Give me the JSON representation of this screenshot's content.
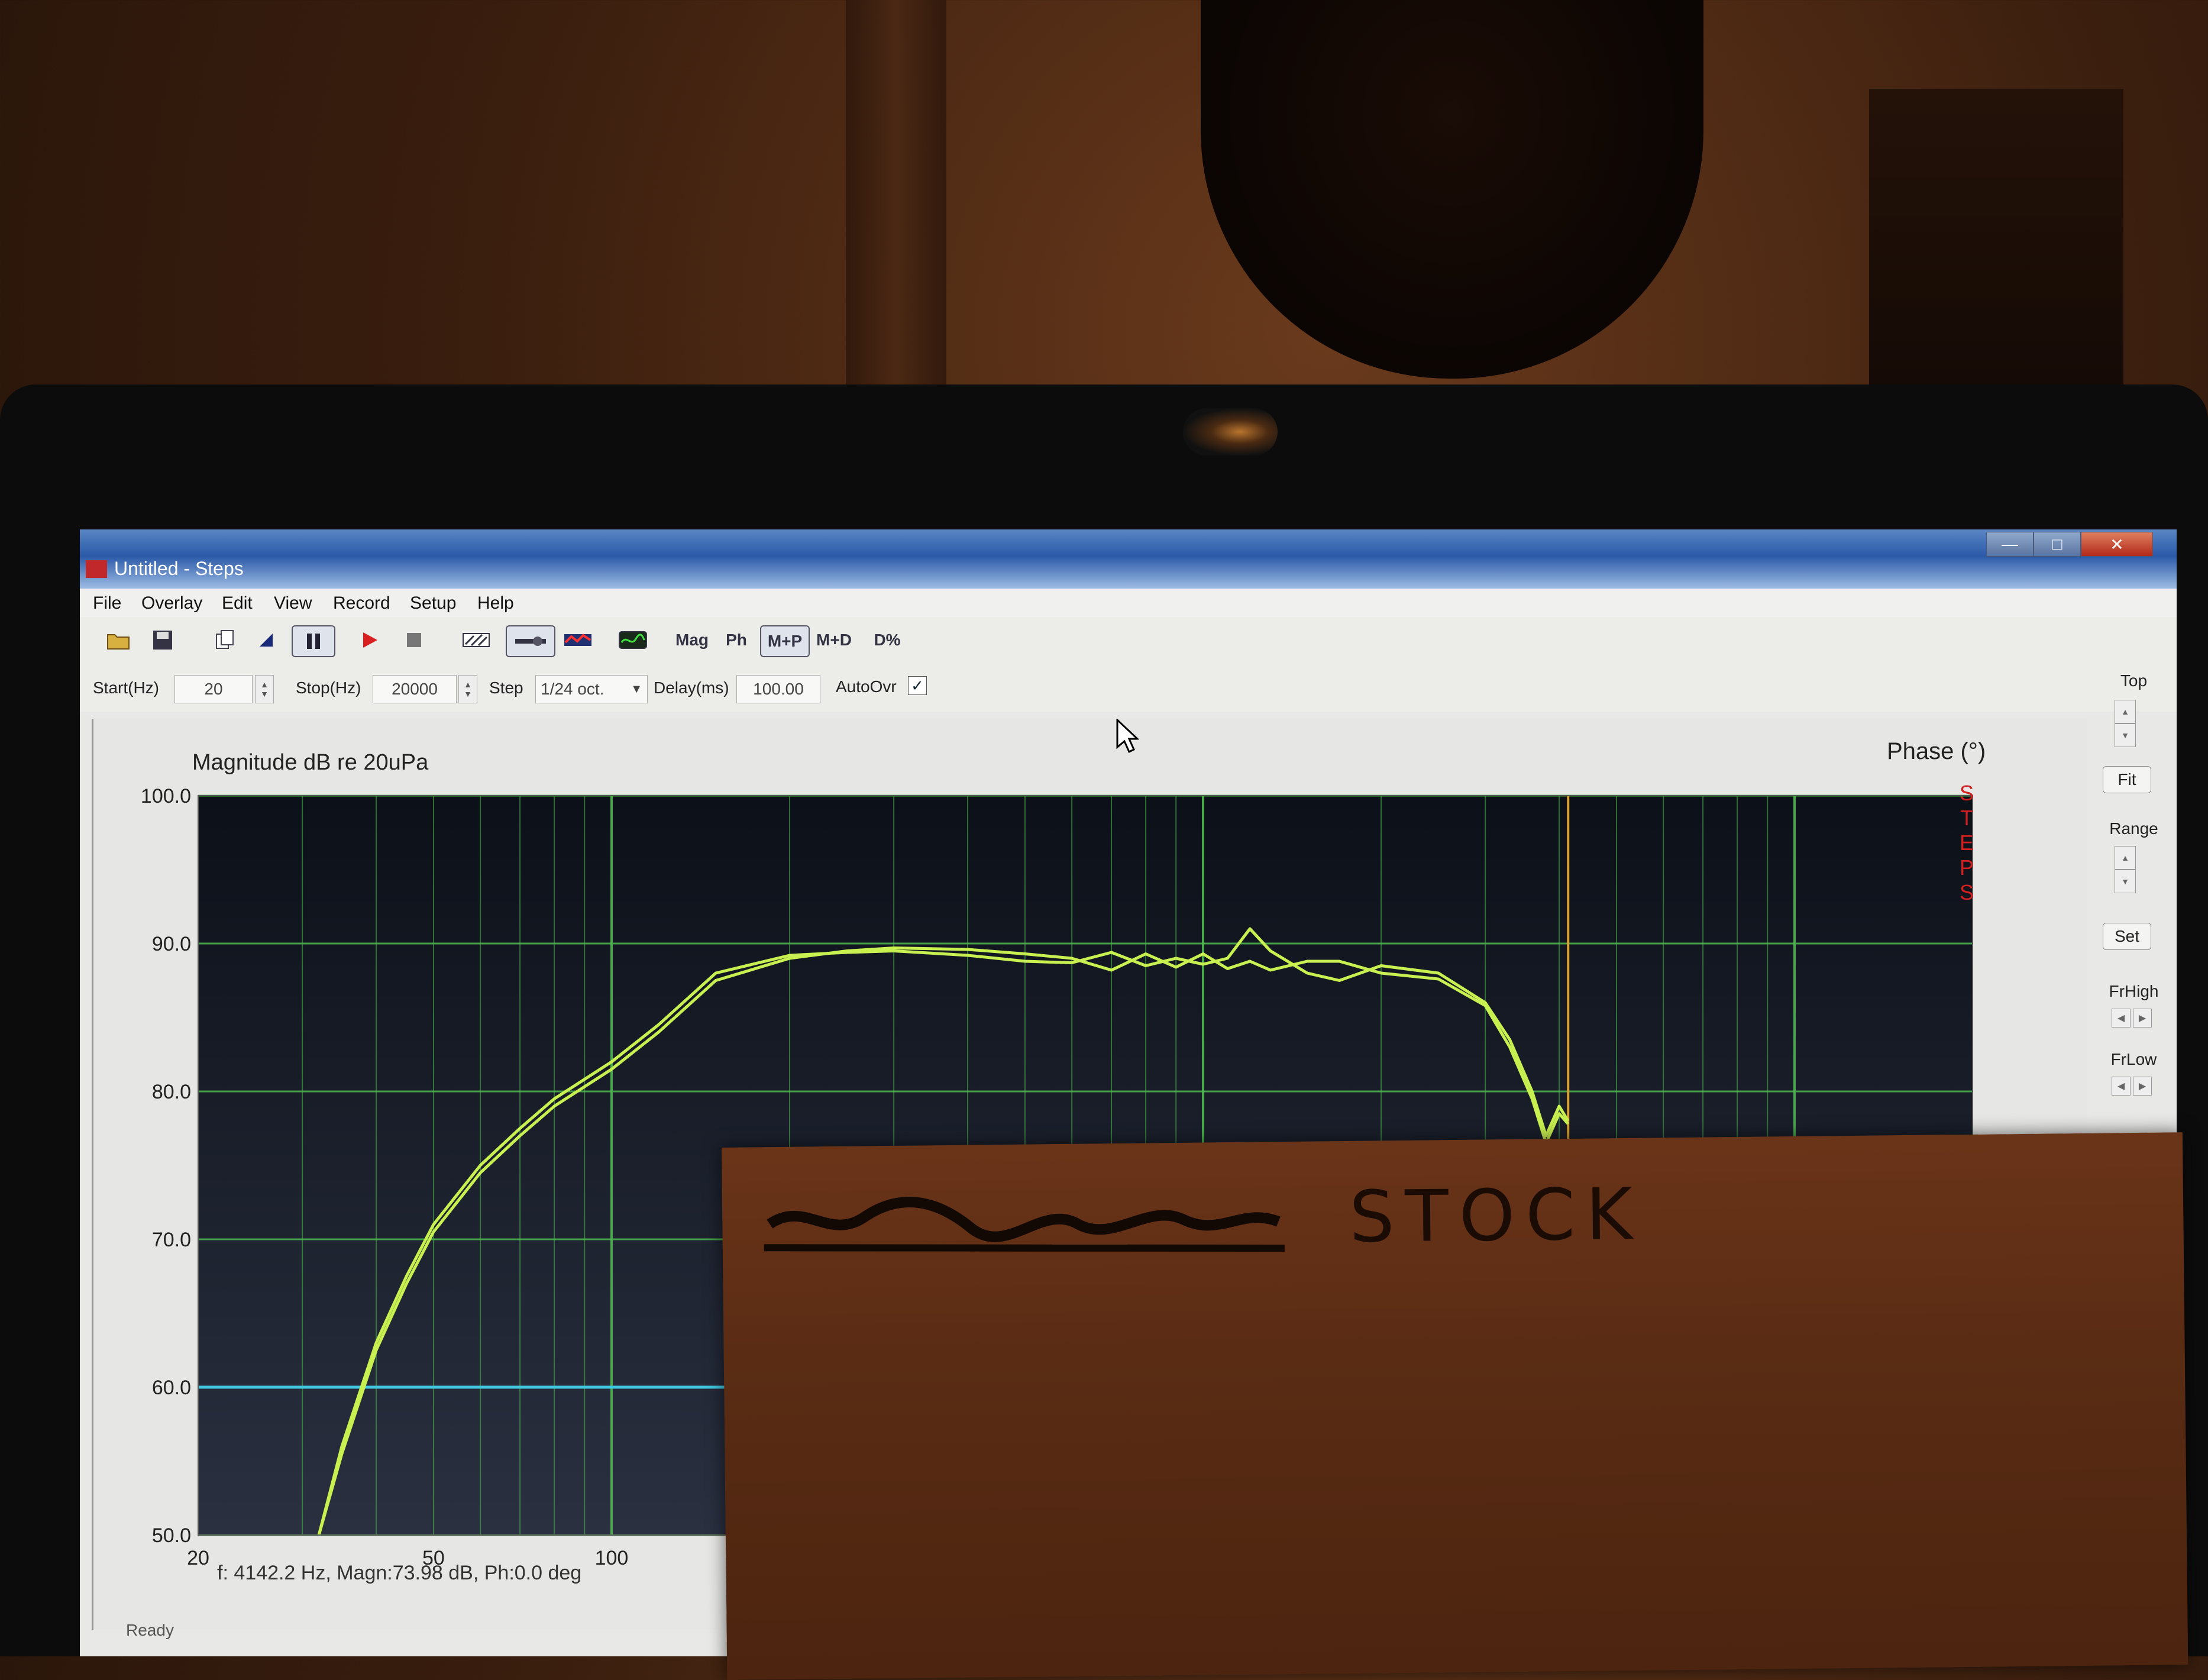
{
  "window": {
    "title": "Untitled - Steps",
    "buttons": [
      "—",
      "□",
      "✕"
    ]
  },
  "menu": [
    "File",
    "Overlay",
    "Edit",
    "View",
    "Record",
    "Setup",
    "Help"
  ],
  "toolbar": {
    "open_icon": "folder-open-icon",
    "save_icon": "floppy-disk-icon",
    "mag_label": "Mag",
    "ph_label": "Ph",
    "mp_label": "M+P",
    "md_label": "M+D",
    "dpct_label": "D%"
  },
  "params": {
    "start_label": "Start(Hz)",
    "start_value": "20",
    "stop_label": "Stop(Hz)",
    "stop_value": "20000",
    "step_label": "Step",
    "step_value": "1/24 oct.",
    "delay_label": "Delay(ms)",
    "delay_value": "100.00",
    "autoovr_label": "AutoOvr",
    "autoovr_checked": "✓"
  },
  "right_panel": {
    "top_label": "Top",
    "fit_label": "Fit",
    "range_label": "Range",
    "set_label": "Set",
    "frhigh_label": "FrHigh",
    "frlow_label": "FrLow"
  },
  "chart_titles": {
    "left": "Magnitude dB re 20uPa",
    "right": "Phase (°)",
    "logo": [
      "S",
      "T",
      "E",
      "P",
      "S"
    ]
  },
  "readout": "f: 4142.2 Hz, Magn:73.98 dB, Ph:0.0 deg",
  "status": "Ready",
  "note_text": "STOCK",
  "colors": {
    "plot_bg": "#141a24",
    "grid": "#4fb84f",
    "trace": "#c8f050",
    "reference_line": "#3fc8e0",
    "cursor": "#d8a030"
  },
  "chart_data": {
    "type": "line",
    "title": "",
    "xlabel": "",
    "ylabel": "Magnitude dB re 20uPa",
    "xscale": "log",
    "xlim": [
      20,
      20000
    ],
    "ylim": [
      50,
      100
    ],
    "y_ticks": [
      "100.0",
      "90.0",
      "80.0",
      "70.0",
      "60.0",
      "50.0"
    ],
    "x_ticks_visible": [
      "20",
      "50",
      "100"
    ],
    "reference_line_y": 60,
    "cursor_x": 4142.2,
    "series": [
      {
        "x": [
          32,
          35,
          40,
          45,
          50,
          60,
          70,
          80,
          100,
          120,
          150,
          200,
          250,
          300,
          400,
          500,
          600,
          700,
          800,
          900,
          1000,
          1100,
          1200,
          1300,
          1500,
          1700,
          2000,
          2500,
          3000,
          3300,
          3600,
          3800,
          4000,
          4142
        ],
        "y": [
          50,
          56,
          63,
          67.5,
          71,
          75,
          77.5,
          79.5,
          82,
          84.5,
          88,
          89.2,
          89.4,
          89.5,
          89.2,
          88.8,
          88.7,
          89.4,
          88.5,
          89,
          88.6,
          89,
          91,
          89.5,
          88,
          87.5,
          88.5,
          88,
          86,
          83.5,
          80,
          77,
          79,
          78
        ]
      },
      {
        "x": [
          32,
          35,
          40,
          45,
          50,
          60,
          70,
          80,
          100,
          120,
          150,
          200,
          250,
          300,
          400,
          500,
          600,
          700,
          800,
          900,
          1000,
          1100,
          1200,
          1300,
          1500,
          1700,
          2000,
          2500,
          3000,
          3300,
          3600,
          3800,
          4000,
          4142
        ],
        "y": [
          50,
          55.5,
          62.5,
          67,
          70.5,
          74.5,
          77,
          79,
          81.5,
          84,
          87.5,
          89,
          89.5,
          89.7,
          89.6,
          89.3,
          89,
          88.2,
          89.3,
          88.4,
          89.3,
          88.3,
          88.8,
          88.2,
          88.8,
          88.8,
          88,
          87.6,
          85.8,
          83,
          79.5,
          76.5,
          78.5,
          77.8
        ]
      }
    ]
  }
}
